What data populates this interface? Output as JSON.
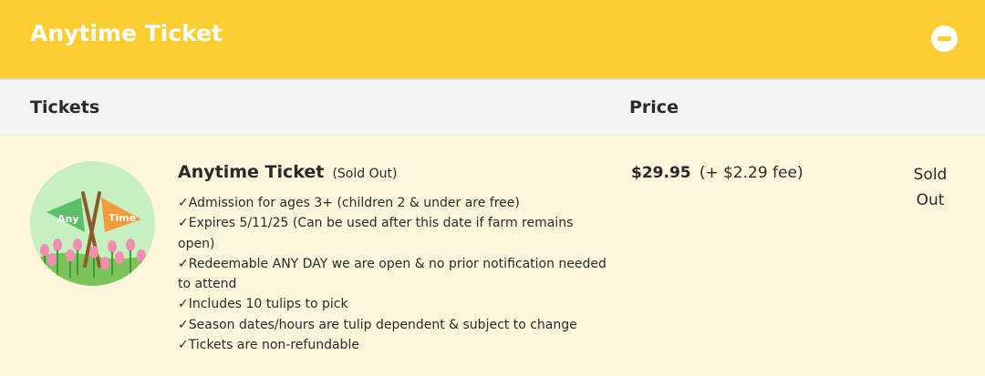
{
  "header": {
    "title": "Anytime Ticket",
    "collapse_icon": "minus-circle-icon",
    "accent_color": "#fcce32"
  },
  "columns": {
    "tickets": "Tickets",
    "price": "Price"
  },
  "ticket": {
    "name": "Anytime Ticket",
    "sold_tag": "(Sold Out)",
    "image_flag_left": "Any",
    "image_flag_right": "Time",
    "check_mark": "✓",
    "features": [
      "Admission for ages 3+ (children 2 & under are free)",
      "Expires 5/11/25 (Can be used after this date if farm remains open)",
      "Redeemable ANY DAY we are open & no prior notification needed to attend",
      "Includes 10 tulips to pick",
      "Season dates/hours are tulip dependent & subject to change",
      "Tickets are non-refundable"
    ],
    "price": "$29.95",
    "fee": "(+ $2.29 fee)",
    "status_line1": "Sold",
    "status_line2": "Out"
  }
}
